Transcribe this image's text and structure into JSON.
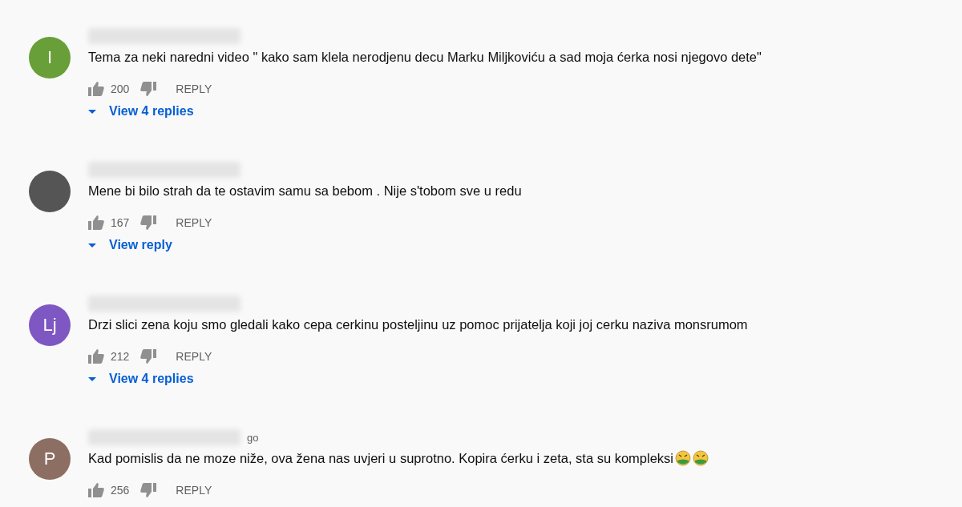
{
  "comments": [
    {
      "avatar": {
        "kind": "letter",
        "letter": "I",
        "color": "#689f38"
      },
      "text": "Tema za neki naredni video \" kako sam klela nerodjenu decu Marku Miljkoviću a sad moja ćerka nosi njegovo dete\"",
      "likes": "200",
      "reply_label": "REPLY",
      "view_replies": "View 4 replies"
    },
    {
      "avatar": {
        "kind": "photo",
        "color": "#555555"
      },
      "text": "Mene bi bilo strah da te ostavim samu sa bebom . Nije s'tobom sve u redu",
      "likes": "167",
      "reply_label": "REPLY",
      "view_replies": "View reply"
    },
    {
      "avatar": {
        "kind": "letter",
        "letter": "Lj",
        "color": "#7e57c2"
      },
      "text": "Drzi slici zena koju smo gledali kako cepa cerkinu posteljinu uz pomoc prijatelja koji joj cerku naziva monsrumom",
      "likes": "212",
      "reply_label": "REPLY",
      "view_replies": "View 4 replies"
    },
    {
      "avatar": {
        "kind": "letter",
        "letter": "P",
        "color": "#8d6e63"
      },
      "time": "go",
      "text": "Kad pomislis da ne moze niže, ova žena nas uvjeri u suprotno. Kopira ćerku i zeta, sta su kompleksi",
      "emoji": [
        {
          "kind": "nauseated"
        },
        {
          "kind": "nauseated"
        }
      ],
      "likes": "256",
      "reply_label": "REPLY"
    }
  ]
}
